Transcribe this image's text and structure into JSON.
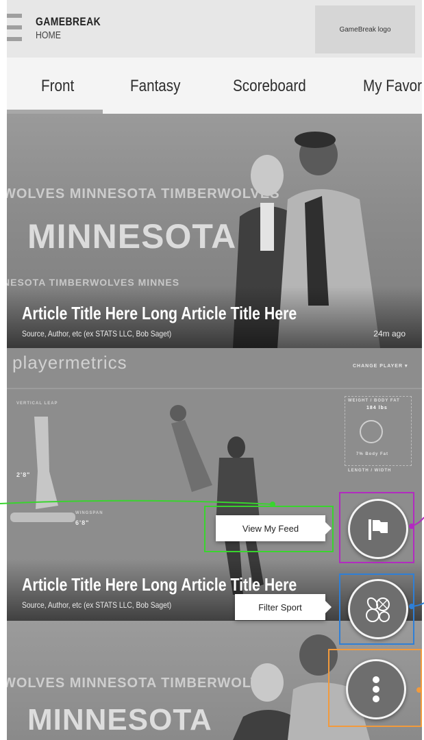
{
  "header": {
    "app_name": "GAMEBREAK",
    "page_name": "HOME",
    "logo_text": "GameBreak logo"
  },
  "tabs": [
    {
      "label": "Front",
      "active": true
    },
    {
      "label": "Fantasy"
    },
    {
      "label": "Scoreboard"
    },
    {
      "label": "My Favor"
    }
  ],
  "articles": [
    {
      "banner_top": "WOLVES  MINNESOTA TIMBERWOLVES",
      "banner_main": "MINNESOTA T",
      "banner_sub": "NESOTA TIMBERWOLVES  MINNES",
      "title": "Article Title Here Long Article Title Here",
      "meta": "Source, Author, etc (ex STATS LLC, Bob Saget)",
      "time": "24m ago"
    },
    {
      "brand": "playermetrics",
      "change_player": "CHANGE PLAYER ▾",
      "weight_label": "WEIGHT / BODY FAT",
      "weight_value": "184 lbs",
      "body_fat": "7% Body Fat",
      "vertical_label": "VERTICAL LEAP",
      "vertical_value": "2'8\"",
      "wingspan_label": "WINGSPAN",
      "wingspan_value": "6'8\"",
      "length_label": "LENGTH / WIDTH",
      "title": "Article Title Here Long Article Title Here",
      "meta": "Source, Author, etc (ex STATS LLC, Bob Saget)"
    },
    {
      "banner_top": "WOLVES  MINNESOTA TIMBERWOLVES",
      "banner_main": "MINNESOTA"
    }
  ],
  "fab_actions": {
    "view_feed": "View My Feed",
    "filter_sport": "Filter Sport"
  },
  "colors": {
    "annot_green": "#39d42e",
    "annot_purple": "#b22bc0",
    "annot_blue": "#2f7fd6",
    "annot_orange": "#f29a3c"
  },
  "icons": [
    "hamburger-icon",
    "flag-icon",
    "sports-balls-icon",
    "more-vertical-icon"
  ]
}
